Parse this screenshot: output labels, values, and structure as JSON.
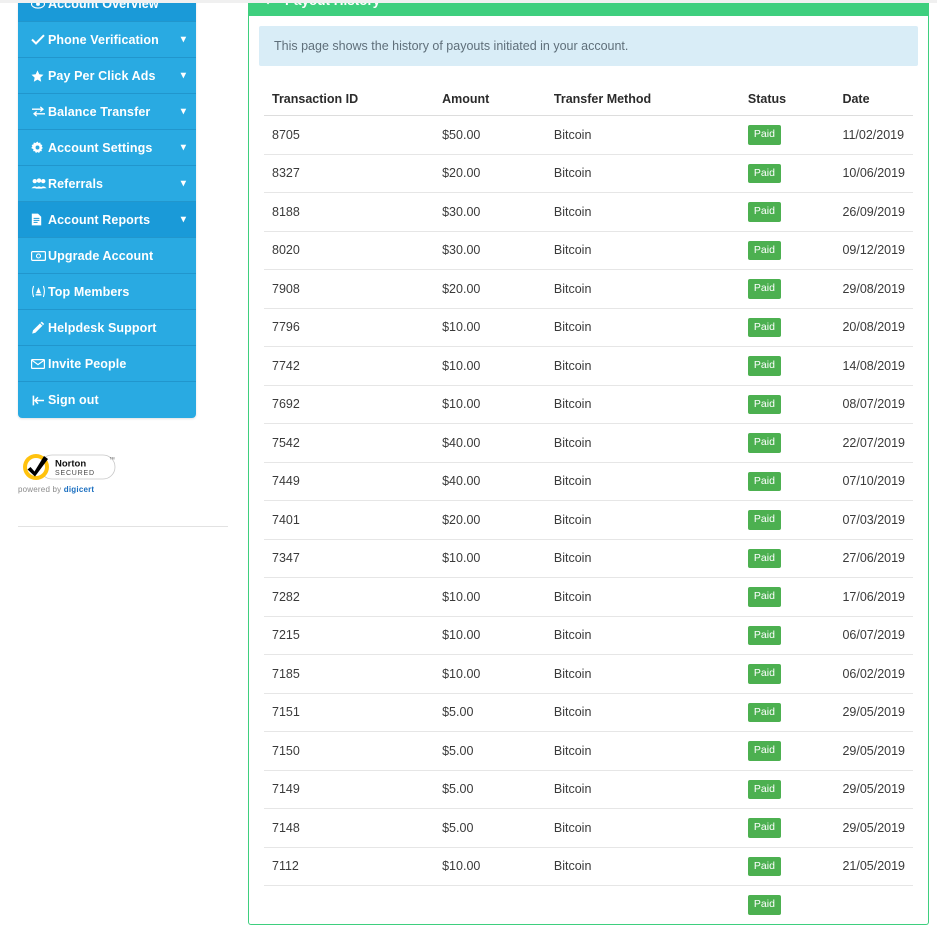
{
  "sidebar": {
    "items": [
      {
        "label": "Account Overview",
        "icon": "eye-icon",
        "caret": false,
        "active": true
      },
      {
        "label": "Phone Verification",
        "icon": "check-icon",
        "caret": true,
        "active": false
      },
      {
        "label": "Pay Per Click Ads",
        "icon": "star-icon",
        "caret": true,
        "active": false
      },
      {
        "label": "Balance Transfer",
        "icon": "exchange-icon",
        "caret": true,
        "active": false
      },
      {
        "label": "Account Settings",
        "icon": "gear-icon",
        "caret": true,
        "active": false
      },
      {
        "label": "Referrals",
        "icon": "users-icon",
        "caret": true,
        "active": false
      },
      {
        "label": "Account Reports",
        "icon": "file-text-icon",
        "caret": true,
        "active": false
      },
      {
        "label": "Upgrade Account",
        "icon": "money-bill-icon",
        "caret": false,
        "active": false
      },
      {
        "label": "Top Members",
        "icon": "award-circle-icon",
        "caret": false,
        "active": false
      },
      {
        "label": "Helpdesk Support",
        "icon": "life-ring-icon",
        "caret": false,
        "active": false
      },
      {
        "label": "Invite People",
        "icon": "envelope-icon",
        "caret": false,
        "active": false
      },
      {
        "label": "Sign out",
        "icon": "sign-out-icon",
        "caret": false,
        "active": false
      }
    ],
    "seal": {
      "name": "Norton",
      "secured": "SECURED",
      "tm": "TM",
      "powered_prefix": "powered by ",
      "powered_brand": "digicert"
    }
  },
  "panel": {
    "header_icon": "arrow-left-icon",
    "title": "Payout History",
    "alert": "This page shows the history of payouts initiated in your account.",
    "accent_green": "#3ecf7e",
    "accent_blue": "#29aae2",
    "badge_green": "#4cb050",
    "alert_bg": "#d9edf7"
  },
  "table": {
    "columns": [
      "Transaction ID",
      "Amount",
      "Transfer Method",
      "Status",
      "Date"
    ],
    "rows": [
      {
        "txn": "8705",
        "amount": "$50.00",
        "method": "Bitcoin",
        "status": "Paid",
        "date": "11/02/2019"
      },
      {
        "txn": "8327",
        "amount": "$20.00",
        "method": "Bitcoin",
        "status": "Paid",
        "date": "10/06/2019"
      },
      {
        "txn": "8188",
        "amount": "$30.00",
        "method": "Bitcoin",
        "status": "Paid",
        "date": "26/09/2019"
      },
      {
        "txn": "8020",
        "amount": "$30.00",
        "method": "Bitcoin",
        "status": "Paid",
        "date": "09/12/2019"
      },
      {
        "txn": "7908",
        "amount": "$20.00",
        "method": "Bitcoin",
        "status": "Paid",
        "date": "29/08/2019"
      },
      {
        "txn": "7796",
        "amount": "$10.00",
        "method": "Bitcoin",
        "status": "Paid",
        "date": "20/08/2019"
      },
      {
        "txn": "7742",
        "amount": "$10.00",
        "method": "Bitcoin",
        "status": "Paid",
        "date": "14/08/2019"
      },
      {
        "txn": "7692",
        "amount": "$10.00",
        "method": "Bitcoin",
        "status": "Paid",
        "date": "08/07/2019"
      },
      {
        "txn": "7542",
        "amount": "$40.00",
        "method": "Bitcoin",
        "status": "Paid",
        "date": "22/07/2019"
      },
      {
        "txn": "7449",
        "amount": "$40.00",
        "method": "Bitcoin",
        "status": "Paid",
        "date": "07/10/2019"
      },
      {
        "txn": "7401",
        "amount": "$20.00",
        "method": "Bitcoin",
        "status": "Paid",
        "date": "07/03/2019"
      },
      {
        "txn": "7347",
        "amount": "$10.00",
        "method": "Bitcoin",
        "status": "Paid",
        "date": "27/06/2019"
      },
      {
        "txn": "7282",
        "amount": "$10.00",
        "method": "Bitcoin",
        "status": "Paid",
        "date": "17/06/2019"
      },
      {
        "txn": "7215",
        "amount": "$10.00",
        "method": "Bitcoin",
        "status": "Paid",
        "date": "06/07/2019"
      },
      {
        "txn": "7185",
        "amount": "$10.00",
        "method": "Bitcoin",
        "status": "Paid",
        "date": "06/02/2019"
      },
      {
        "txn": "7151",
        "amount": "$5.00",
        "method": "Bitcoin",
        "status": "Paid",
        "date": "29/05/2019"
      },
      {
        "txn": "7150",
        "amount": "$5.00",
        "method": "Bitcoin",
        "status": "Paid",
        "date": "29/05/2019"
      },
      {
        "txn": "7149",
        "amount": "$5.00",
        "method": "Bitcoin",
        "status": "Paid",
        "date": "29/05/2019"
      },
      {
        "txn": "7148",
        "amount": "$5.00",
        "method": "Bitcoin",
        "status": "Paid",
        "date": "29/05/2019"
      },
      {
        "txn": "7112",
        "amount": "$10.00",
        "method": "Bitcoin",
        "status": "Paid",
        "date": "21/05/2019"
      },
      {
        "txn": "",
        "amount": "",
        "method": "",
        "status": "Paid",
        "date": ""
      }
    ]
  }
}
